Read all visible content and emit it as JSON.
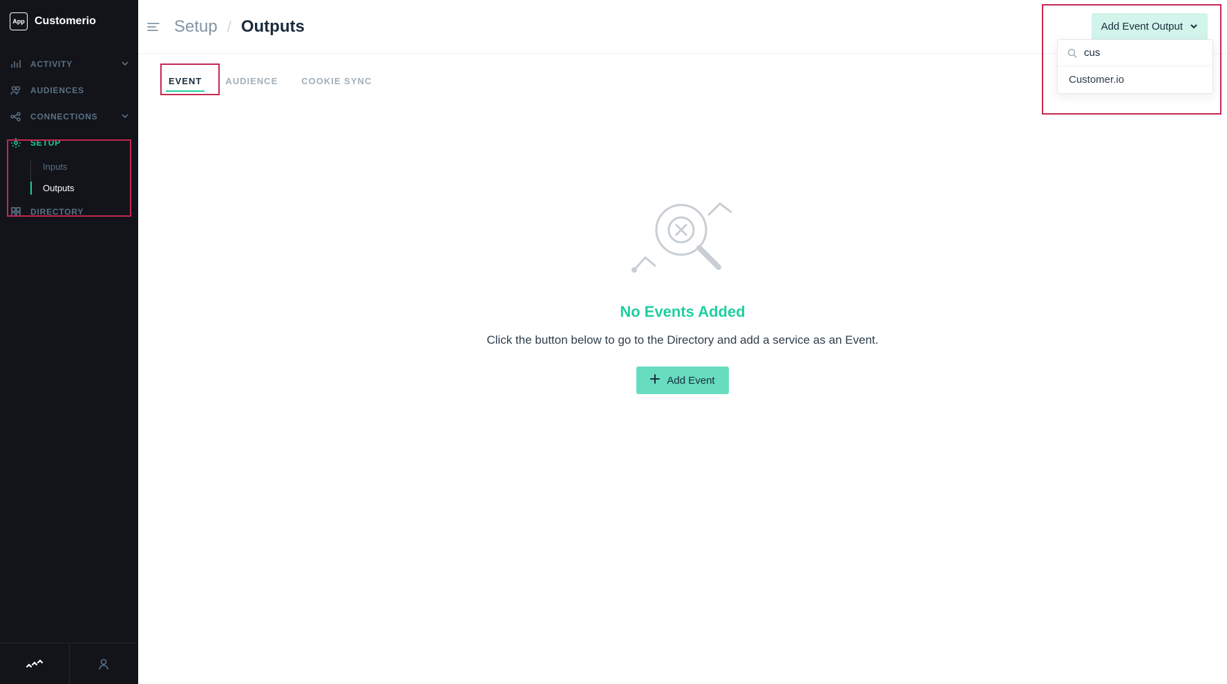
{
  "sidebar": {
    "app_badge": "App",
    "app_name": "Customerio",
    "nav": {
      "activity": "Activity",
      "audiences": "Audiences",
      "connections": "Connections",
      "setup": "Setup",
      "directory": "Directory"
    },
    "setup_sub": {
      "inputs": "Inputs",
      "outputs": "Outputs"
    }
  },
  "breadcrumb": {
    "parent": "Setup",
    "current": "Outputs"
  },
  "topbar": {
    "add_output_label": "Add Event Output",
    "search_value": "cus",
    "dropdown_option_1": "Customer.io"
  },
  "tabs": {
    "event": "Event",
    "audience": "Audience",
    "cookie_sync": "Cookie Sync"
  },
  "empty": {
    "title": "No Events Added",
    "description": "Click the button below to go to the Directory and add a service as an Event.",
    "add_event_label": "Add Event"
  }
}
